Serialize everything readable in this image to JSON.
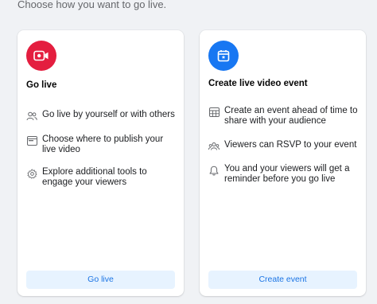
{
  "header": {
    "subtitle": "Choose how you want to go live."
  },
  "go_live_card": {
    "title": "Go live",
    "icon": "video-camera-icon",
    "features": [
      {
        "icon": "people-icon",
        "text": "Go live by yourself or with others"
      },
      {
        "icon": "window-icon",
        "text": "Choose where to publish your live video"
      },
      {
        "icon": "gear-icon",
        "text": "Explore additional tools to engage your viewers"
      }
    ],
    "button_label": "Go live"
  },
  "event_card": {
    "title": "Create live video event",
    "icon": "calendar-star-icon",
    "features": [
      {
        "icon": "calendar-grid-icon",
        "text": "Create an event ahead of time to share with your audience"
      },
      {
        "icon": "group-icon",
        "text": "Viewers can RSVP to your event"
      },
      {
        "icon": "bell-icon",
        "text": "You and your viewers will get a reminder before you go live"
      }
    ],
    "button_label": "Create event"
  },
  "colors": {
    "go_live_accent": "#e41e3f",
    "event_accent": "#1877f2",
    "button_bg": "#e7f3ff",
    "button_text": "#1b74e4"
  }
}
